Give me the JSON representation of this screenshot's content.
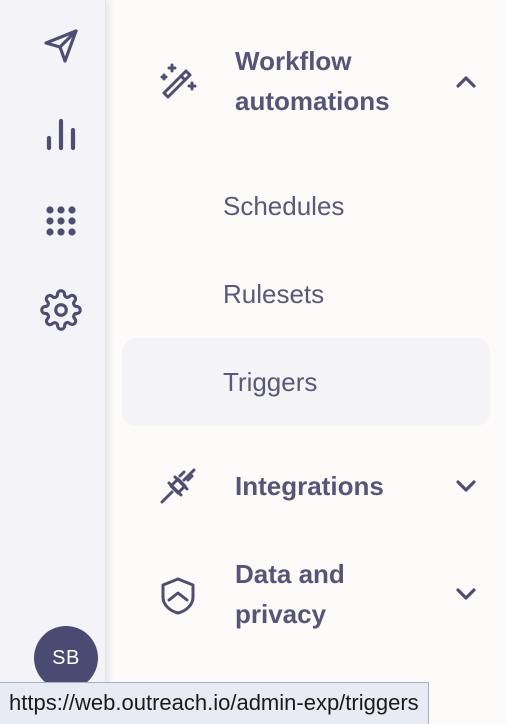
{
  "rail": {
    "items": [
      {
        "name": "send-icon"
      },
      {
        "name": "bar-chart-icon"
      },
      {
        "name": "apps-grid-icon"
      },
      {
        "name": "gear-icon"
      }
    ],
    "avatar_initials": "SB"
  },
  "nav": {
    "workflow": {
      "title_line1": "Workflow",
      "title_line2": "automations",
      "icon": "magic-wand-icon",
      "expanded": true,
      "items": [
        {
          "label": "Schedules",
          "active": false
        },
        {
          "label": "Rulesets",
          "active": false
        },
        {
          "label": "Triggers",
          "active": true
        }
      ]
    },
    "integrations": {
      "title": "Integrations",
      "icon": "plug-icon",
      "expanded": false
    },
    "privacy": {
      "title_line1": "Data and",
      "title_line2": "privacy",
      "icon": "shield-icon",
      "expanded": false
    }
  },
  "status_bar": {
    "url": "https://web.outreach.io/admin-exp/triggers"
  },
  "colors": {
    "icon": "#4f4e72",
    "text": "#565577",
    "avatar_bg": "#4b4a73",
    "active_bg": "#f4f4f6",
    "rail_bg": "#f4f4f8"
  }
}
